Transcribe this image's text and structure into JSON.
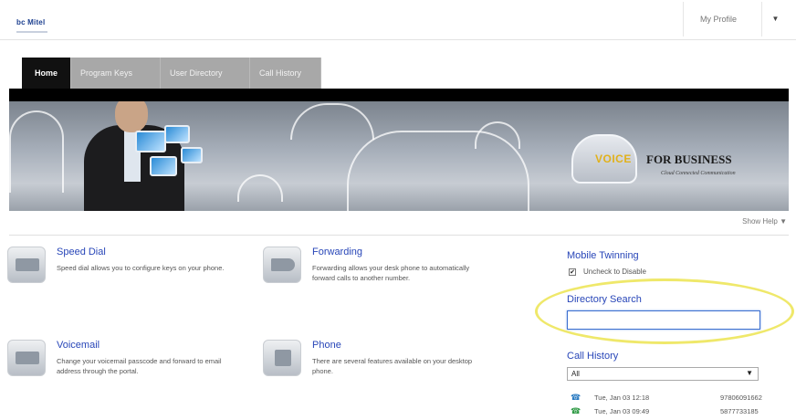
{
  "header": {
    "logo_text": "bc Mitel",
    "profile_label": "My Profile",
    "menu_caret": "▼"
  },
  "tabs": [
    {
      "label": "Home",
      "active": true
    },
    {
      "label": "Program Keys",
      "active": false
    },
    {
      "label": "User Directory",
      "active": false
    },
    {
      "label": "Call History",
      "active": false
    }
  ],
  "banner": {
    "brand_voice": "VOICE",
    "brand_rest": "FOR BUSINESS",
    "tagline": "Cloud Connected Communication"
  },
  "help": {
    "label": "Show Help ▼"
  },
  "features": [
    {
      "title": "Speed Dial",
      "desc": "Speed dial allows you to configure keys on your phone.",
      "icon": "speed-dial-icon"
    },
    {
      "title": "Forwarding",
      "desc": "Forwarding allows your desk phone to automatically forward calls to another number.",
      "icon": "forwarding-icon"
    },
    {
      "title": "Voicemail",
      "desc": "Change your voicemail passcode and forward to email address through the portal.",
      "icon": "voicemail-icon"
    },
    {
      "title": "Phone",
      "desc": "There are several features available on your desktop phone.",
      "icon": "phone-icon"
    }
  ],
  "sidebar": {
    "mobile_twinning": {
      "title": "Mobile Twinning",
      "checkbox_label": "Uncheck to Disable",
      "checked": true
    },
    "directory_search": {
      "title": "Directory Search",
      "value": ""
    },
    "call_history": {
      "title": "Call History",
      "filter": "All",
      "entries": [
        {
          "time": "Tue, Jan 03 12:18",
          "number": "97806091662"
        },
        {
          "time": "Tue, Jan 03 09:49",
          "number": "5877733185"
        }
      ]
    }
  },
  "colors": {
    "link": "#2846b8",
    "active_tab": "#111111",
    "highlight_ring": "#efe86a"
  }
}
